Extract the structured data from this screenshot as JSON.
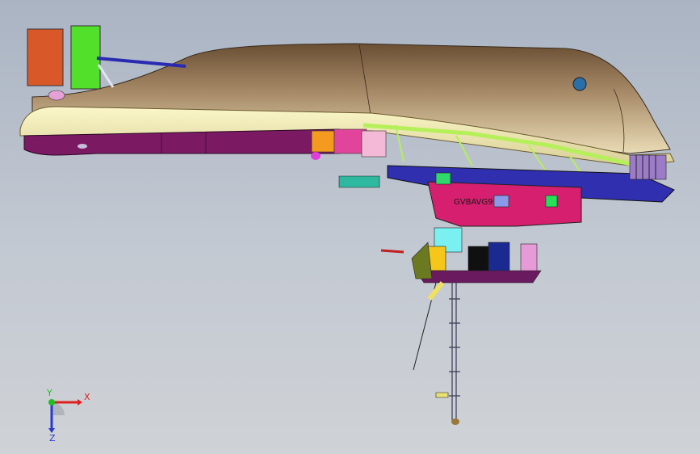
{
  "viewport": {
    "background_top": "#aab4c3",
    "background_bottom": "#cfd2d6"
  },
  "model": {
    "hull_color": "#9c7f5c",
    "deck_color": "#f3f0bc",
    "underside_color": "#7b1a63",
    "pipe_color": "#b5f05a",
    "band_color": "#2f2fb0",
    "module_color": "#d61f6e",
    "hull_label": "GVBAVG9"
  },
  "triad": {
    "x_label": "X",
    "y_label": "Y",
    "z_label": "Z",
    "x_color": "#e02020",
    "y_color": "#1fbf1f",
    "z_color": "#2a3ad0"
  }
}
